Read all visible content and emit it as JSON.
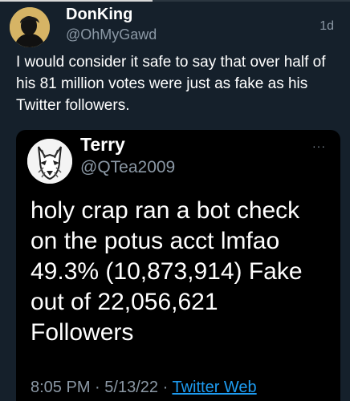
{
  "tweet": {
    "author_name": "DonKing",
    "author_handle": "@OhMyGawd",
    "timestamp": "1d",
    "text": "I would consider it safe to say that over half of his 81 million votes were just as fake as his Twitter followers."
  },
  "quoted_tweet": {
    "author_name": "Terry",
    "author_handle": "@QTea2009",
    "more_label": "···",
    "lines": [
      "holy crap ran a bot check",
      "on the potus acct lmfao",
      "49.3% (10,873,914) Fake",
      "out of 22,056,621",
      "Followers"
    ],
    "time": "8:05 PM",
    "separator": "·",
    "date": "5/13/22",
    "source": "Twitter Web"
  },
  "colors": {
    "background": "#15202b",
    "card": "#000000",
    "text": "#ffffff",
    "muted": "#8b98a5",
    "link": "#1d9bf0"
  }
}
